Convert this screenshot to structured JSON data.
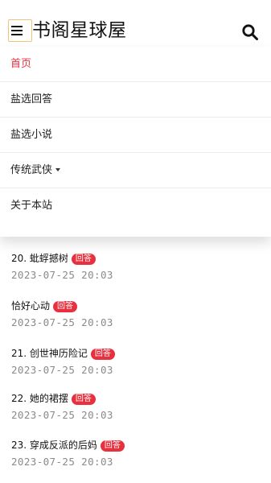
{
  "header": {
    "site_title": "书阁星球屋",
    "menu_icon": "hamburger-icon",
    "search_icon": "search-icon"
  },
  "nav": {
    "items": [
      {
        "label": "首页",
        "active": true
      },
      {
        "label": "盐选回答"
      },
      {
        "label": "盐选小说"
      },
      {
        "label": "传统武侠",
        "has_dropdown": true
      },
      {
        "label": "关于本站"
      }
    ]
  },
  "list": {
    "badge_label": "回答",
    "items": [
      {
        "title": "20. 蚍蜉撼树",
        "date": "2023-07-25 20:03"
      },
      {
        "title": "恰好心动",
        "date": "2023-07-25 20:03"
      },
      {
        "title": "21. 创世神历险记",
        "date": "2023-07-25 20:03"
      },
      {
        "title": "22. 她的裙摆",
        "date": "2023-07-25 20:03"
      },
      {
        "title": "23. 穿成反派的后妈",
        "date": "2023-07-25 20:03"
      }
    ]
  },
  "colors": {
    "accent": "#e8313f",
    "date_text": "#8a8a8a",
    "menu_outline": "#f0c27a"
  }
}
